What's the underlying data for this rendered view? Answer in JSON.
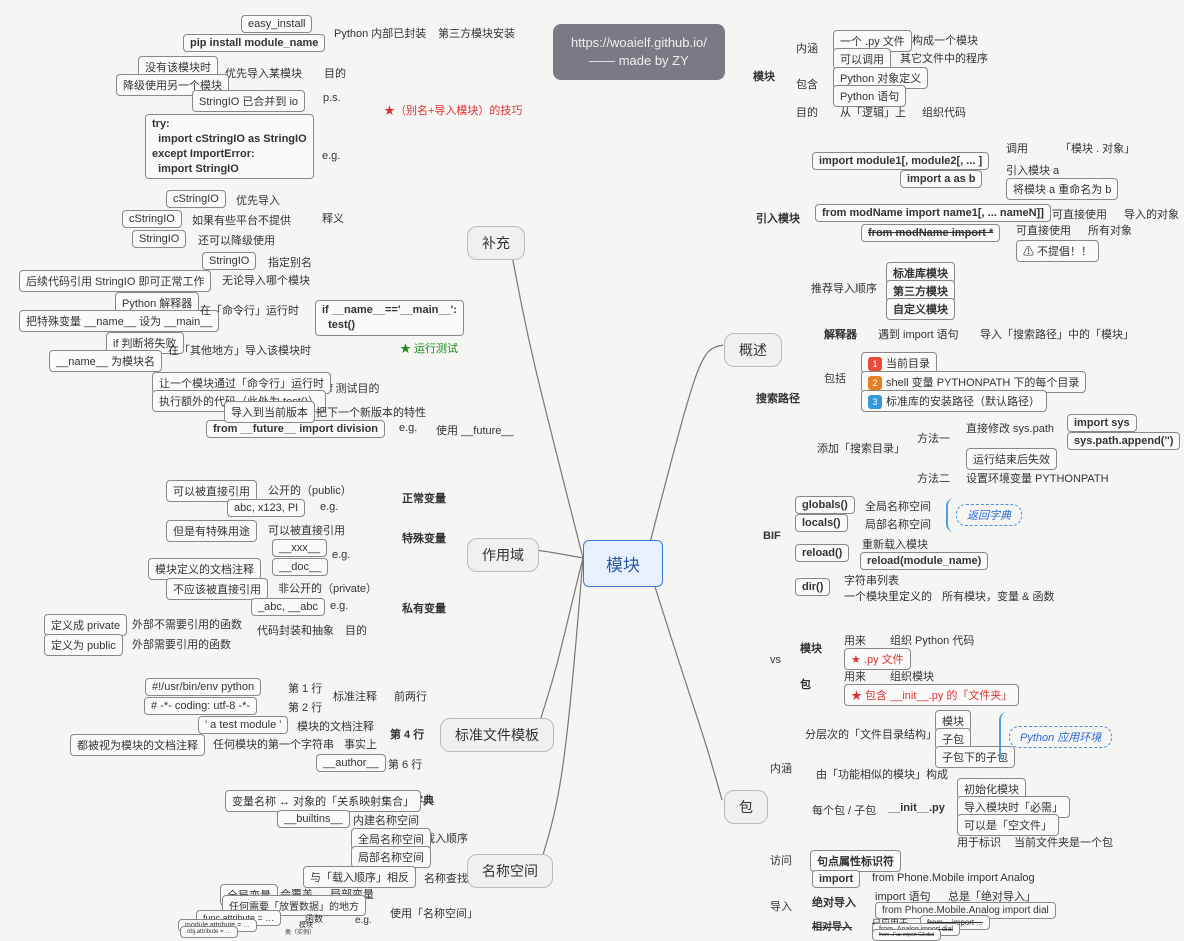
{
  "credit": {
    "line1": "https://woaielf.github.io/",
    "line2": "—— made by ZY"
  },
  "root": "模块",
  "L1": {
    "补充": "补充",
    "作用域": "作用域",
    "标准文件模板": "标准文件模板",
    "名称空间": "名称空间"
  },
  "R1": {
    "概述": "概述",
    "包": "包"
  },
  "supp": {
    "first": {
      "a": "easy_install",
      "b": "pip install module_name",
      "c": "Python 内部已封装",
      "d": "第三方模块安装"
    },
    "tips": {
      "tag": "★（别名+导入模块）的技巧",
      "目的": "目的",
      "优先导入某模块": "优先导入某模块",
      "没有该模块时": "没有该模块时",
      "降级使用另一个模块": "降级使用另一个模块",
      "ps": "p.s.",
      "stringio_io": "StringIO 已合并到 io",
      "eg": "e.g.",
      "code": "try:\n  import cStringIO as StringIO\nexcept ImportError:\n  import StringIO",
      "释义": "释义",
      "c1": "cStringIO",
      "c1d": "优先导入",
      "c2": "cStringIO",
      "c2d": "如果有些平台不提供",
      "c3": "StringIO",
      "c3d": "还可以降级使用",
      "c4": "StringIO",
      "c4d": "指定别名",
      "tail": "后续代码引用 StringIO 即可正常工作",
      "tail2": "无论导入哪个模块"
    },
    "run": {
      "tag": "★ 运行测试",
      "if_name": "if __name__=='__main__':\n  test()",
      "python_int": "Python 解释器",
      "set_main": "把特殊变量 __name__ 设为 __main__",
      "cmd": "在「命令行」运行时",
      "fail": "if 判断将失败",
      "other": "在「其他地方」导入该模块时",
      "mod_name": "__name__ 为模块名",
      "test_goal": "if 测试目的",
      "let1": "让一个模块通过「命令行」运行时",
      "let2": "执行额外的代码（此处为 test()）",
      "future": "使用 __future__",
      "eg2": "e.g.",
      "import_div": "from __future__ import division",
      "desc": "把下一个新版本的特性",
      "desc2": "导入到当前版本"
    }
  },
  "scope": {
    "正常变量": "正常变量",
    "特殊变量": "特殊变量",
    "私有变量": "私有变量",
    "n1": "可以被直接引用",
    "n2": "公开的（public）",
    "n3": "abc, x123, PI",
    "eg": "e.g.",
    "s1": "但是有特殊用途",
    "s2": "可以被直接引用",
    "s3": "__xxx__",
    "s4": "__doc__",
    "s5": "模块定义的文档注释",
    "p1": "不应该被直接引用",
    "p2": "非公开的（private）",
    "p3": "_abc, __abc",
    "目的": "目的",
    "p4": "代码封装和抽象",
    "def1": "定义成 private",
    "def1d": "外部不需要引用的函数",
    "def2": "定义为 public",
    "def2d": "外部需要引用的函数"
  },
  "tmpl": {
    "标准注释": "标准注释",
    "前两行": "前两行",
    "l1": "#!/usr/bin/env python",
    "l1t": "第 1 行",
    "l2": "# -*- coding: utf-8 -*-",
    "l2t": "第 2 行",
    "l4": "第 4 行",
    "doc": "模块的文档注释",
    "test": "' a test module '",
    "anymod": "任何模块的第一个字符串",
    "fact": "事实上",
    "wrong": "都被视为模块的文档注释",
    "l6": "第 6 行",
    "author": "__author__"
  },
  "ns": {
    "字典": "字典",
    "map": "变量名称 ↔ 对象的「关系映射集合」",
    "builtins": "__builtins__",
    "bud": "内建名称空间",
    "载入顺序": "载入顺序",
    "gl": "全局名称空间",
    "lo": "局部名称空间",
    "名称查找": "名称查找",
    "rev": "与「载入顺序」相反",
    "override": "会覆盖",
    "g2": "全局变量",
    "l2": "局部变量",
    "use": "使用「名称空间」",
    "any": "任何需要「放置数据」的地方",
    "eg": "e.g.",
    "a1": "func.attribute = …",
    "a1d": "函数",
    "a2": "module.attribute = …",
    "a2d": "模块",
    "a3": "obj.attribute = …",
    "a3d": "类（实例）"
  },
  "summary": {
    "模块": "模块",
    "内涵": "内涵",
    "py": "一个 .py 文件",
    "build": "构成一个模块",
    "use": "可以调用",
    "other": "其它文件中的程序",
    "包含": "包含",
    "obj": "Python 对象定义",
    "stmt": "Python 语句",
    "目的": "目的",
    "logic": "从「逻辑」上",
    "org": "组织代码",
    "引入模块": "引入模块",
    "im1": "import module1[, module2[, ... ]",
    "调用": "调用",
    "call_obj": "「模块 . 对象」",
    "im2": "import a as b",
    "in_a": "引入模块 a",
    "rename": "将模块 a 重命名为 b",
    "im3": "from modName import name1[, ... nameN]]",
    "直接使用": "可直接使用",
    "导入对象": "导入的对象",
    "im4": "from modName import *",
    "allobj": "所有对象",
    "warn": "⚠ 不提倡！！",
    "推荐导入顺序": "推荐导入顺序",
    "std": "标准库模块",
    "third": "第三方模块",
    "self": "自定义模块",
    "搜索路径": "搜索路径",
    "解释器": "解释器",
    "meet": "遇到 import 语句",
    "search": "导入「搜索路径」中的「模块」",
    "包括": "包括",
    "cur": "当前目录",
    "pp": "shell 变量 PYTHONPATH 下的每个目录",
    "stdpath": "标准库的安装路径（默认路径）",
    "添加": "添加「搜索目录」",
    "m1": "方法一",
    "m1d": "直接修改 sys.path",
    "m1a": "import sys",
    "m1b": "sys.path.append('')",
    "m1c": "运行结束后失效",
    "m2": "方法二",
    "m2d": "设置环境变量 PYTHONPATH",
    "BIF": "BIF",
    "globals": "globals()",
    "gns": "全局名称空间",
    "locals": "locals()",
    "lns": "局部名称空间",
    "返回字典": "返回字典",
    "reload": "reload()",
    "rd1": "重新载入模块",
    "rd2": "reload(module_name)",
    "dir": "dir()",
    "dir1": "字符串列表",
    "dir2": "一个模块里定义的",
    "dir3": "所有模块，变量 & 函数"
  },
  "pkg": {
    "vs": "vs",
    "模块": "模块",
    "mu": "用来",
    "morg": "组织 Python 代码",
    "mpy": "★ .py 文件",
    "包": "包",
    "porg": "组织模块",
    "pfld": "★ 包含 __init__.py 的「文件夹」",
    "内涵": "内涵",
    "层次": "分层次的「文件目录结构」",
    "m": "模块",
    "sub": "子包",
    "subm": "子包下的子包",
    "app": "Python 应用环境",
    "fun": "由「功能相似的模块」构成",
    "每个包": "每个包 / 子包",
    "init": "__init__.py",
    "i1": "初始化模块",
    "i2": "导入模块时「必需」",
    "i3": "可以是「空文件」",
    "i4": "用于标识",
    "i5": "当前文件夹是一个包",
    "访问": "访问",
    "dot": "句点属性标识符",
    "导入": "导入",
    "import": "import",
    "imp_eg": "from Phone.Mobile import Analog",
    "绝对导入": "绝对导入",
    "abs1": "import 语句",
    "abs2": "总是「绝对导入」",
    "abs3": "from Phone.Mobile.Analog import dial",
    "相对导入": "相对导入",
    "r0": "只应用于",
    "r1": "from .. import ...",
    "r2": "from .Analog import dial",
    "r3": "from ..Fax import G3.dial"
  }
}
